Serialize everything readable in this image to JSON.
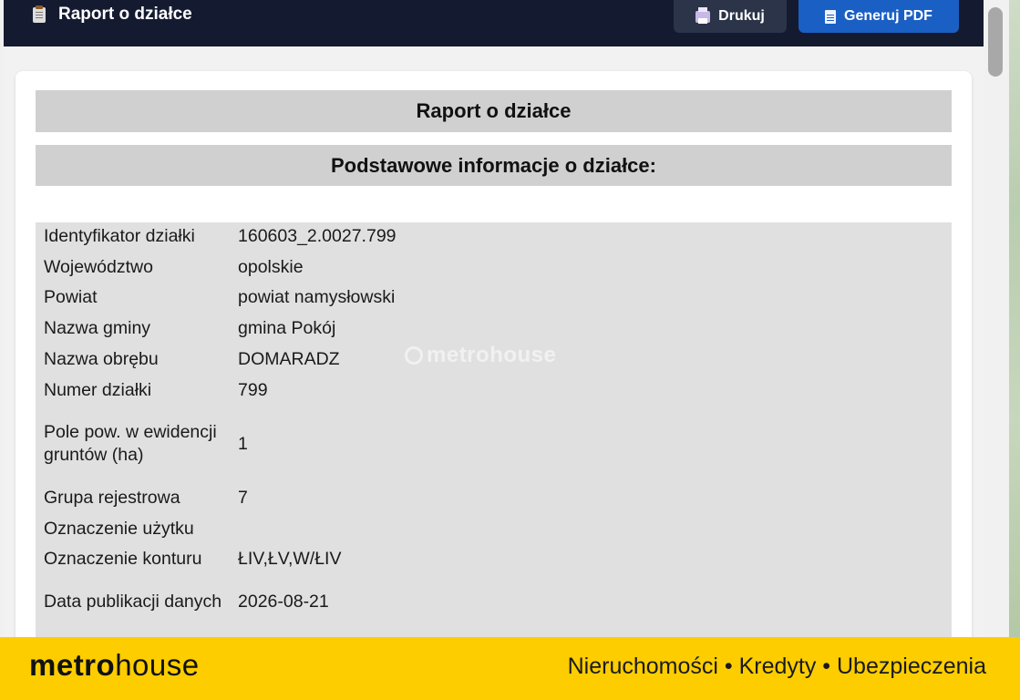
{
  "header": {
    "title": "Raport o działce",
    "print_label": "Drukuj",
    "pdf_label": "Generuj PDF"
  },
  "report": {
    "title": "Raport o działce",
    "section_title": "Podstawowe informacje o działce:",
    "rows": [
      {
        "label": "Identyfikator działki",
        "value": "160603_2.0027.799"
      },
      {
        "label": "Województwo",
        "value": "opolskie"
      },
      {
        "label": "Powiat",
        "value": "powiat namysłowski"
      },
      {
        "label": "Nazwa gminy",
        "value": "gmina Pokój"
      },
      {
        "label": "Nazwa obrębu",
        "value": "DOMARADZ"
      },
      {
        "label": "Numer działki",
        "value": "799"
      },
      {
        "label": "Pole pow. w ewidencji gruntów (ha)",
        "value": "1"
      },
      {
        "label": "Grupa rejestrowa",
        "value": "7"
      },
      {
        "label": "Oznaczenie użytku",
        "value": ""
      },
      {
        "label": "Oznaczenie konturu",
        "value": "ŁIV,ŁV,W/ŁIV"
      },
      {
        "label": "Data publikacji danych",
        "value": "2026-08-21"
      }
    ]
  },
  "watermark": {
    "brand_light": "metro",
    "brand_bold": "house"
  },
  "banner": {
    "brand_bold": "metro",
    "brand_light": "house",
    "tagline": "Nieruchomości • Kredyty • Ubezpieczenia"
  },
  "colors": {
    "topbar": "#141a30",
    "print_button": "#2b3448",
    "pdf_button": "#1a5fc4",
    "section_header": "#d0d0d0",
    "table_bg": "#e0e0e0",
    "banner": "#fdcd00"
  },
  "icons": [
    "clipboard-icon",
    "printer-icon",
    "pdf-file-icon"
  ]
}
